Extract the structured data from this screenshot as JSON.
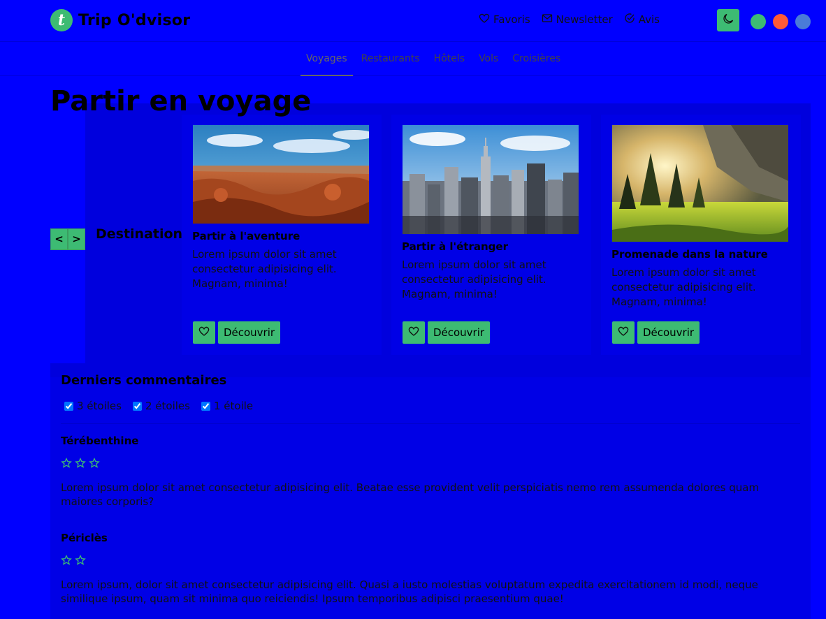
{
  "brand": {
    "logo_letter": "t",
    "name": "Trip O'dvisor"
  },
  "top_links": [
    {
      "label": "Favoris",
      "icon": "heart-icon"
    },
    {
      "label": "Newsletter",
      "icon": "envelope-icon"
    },
    {
      "label": "Avis",
      "icon": "check-circle-icon"
    }
  ],
  "dark_mode_icon": "moon-icon",
  "theme_colors": [
    "#3dbb73",
    "#ff5a36",
    "#4a7bd8"
  ],
  "nav": {
    "items": [
      "Voyages",
      "Restaurants",
      "Hôtels",
      "Vols",
      "Croisières"
    ],
    "active": "Voyages"
  },
  "page_title": "Partir en voyage",
  "carousel": {
    "prev_label": "<",
    "next_label": ">",
    "section_label": "Destinations",
    "cards": [
      {
        "title": "Partir à l'aventure",
        "image": "canyon-desert-photo",
        "text": "Lorem ipsum dolor sit amet consectetur adipisicing elit. Magnam, minima!",
        "button": "Découvrir"
      },
      {
        "title": "Partir à l'étranger",
        "image": "city-skyline-photo",
        "text": "Lorem ipsum dolor sit amet consectetur adipisicing elit. Magnam, minima!",
        "button": "Découvrir"
      },
      {
        "title": "Promenade dans la nature",
        "image": "forest-valley-photo",
        "text": "Lorem ipsum dolor sit amet consectetur adipisicing elit. Magnam, minima!",
        "button": "Découvrir"
      }
    ]
  },
  "comments": {
    "title": "Derniers commentaires",
    "filters": [
      {
        "label": "3 étoiles",
        "checked": true
      },
      {
        "label": "2 étoiles",
        "checked": true
      },
      {
        "label": "1 étoile",
        "checked": true
      }
    ],
    "items": [
      {
        "author": "Térébenthine",
        "stars": 3,
        "text": "Lorem ipsum dolor sit amet consectetur adipisicing elit. Beatae esse provident velit perspiciatis nemo rem assumenda dolores quam maiores corporis?"
      },
      {
        "author": "Périclès",
        "stars": 2,
        "text": "Lorem ipsum, dolor sit amet consectetur adipisicing elit. Quasi a iusto molestias voluptatum expedita exercitationem id modi, neque similique ipsum, quam sit minima quo reiciendis! Ipsum temporibus adipisci praesentium quae!"
      }
    ]
  }
}
